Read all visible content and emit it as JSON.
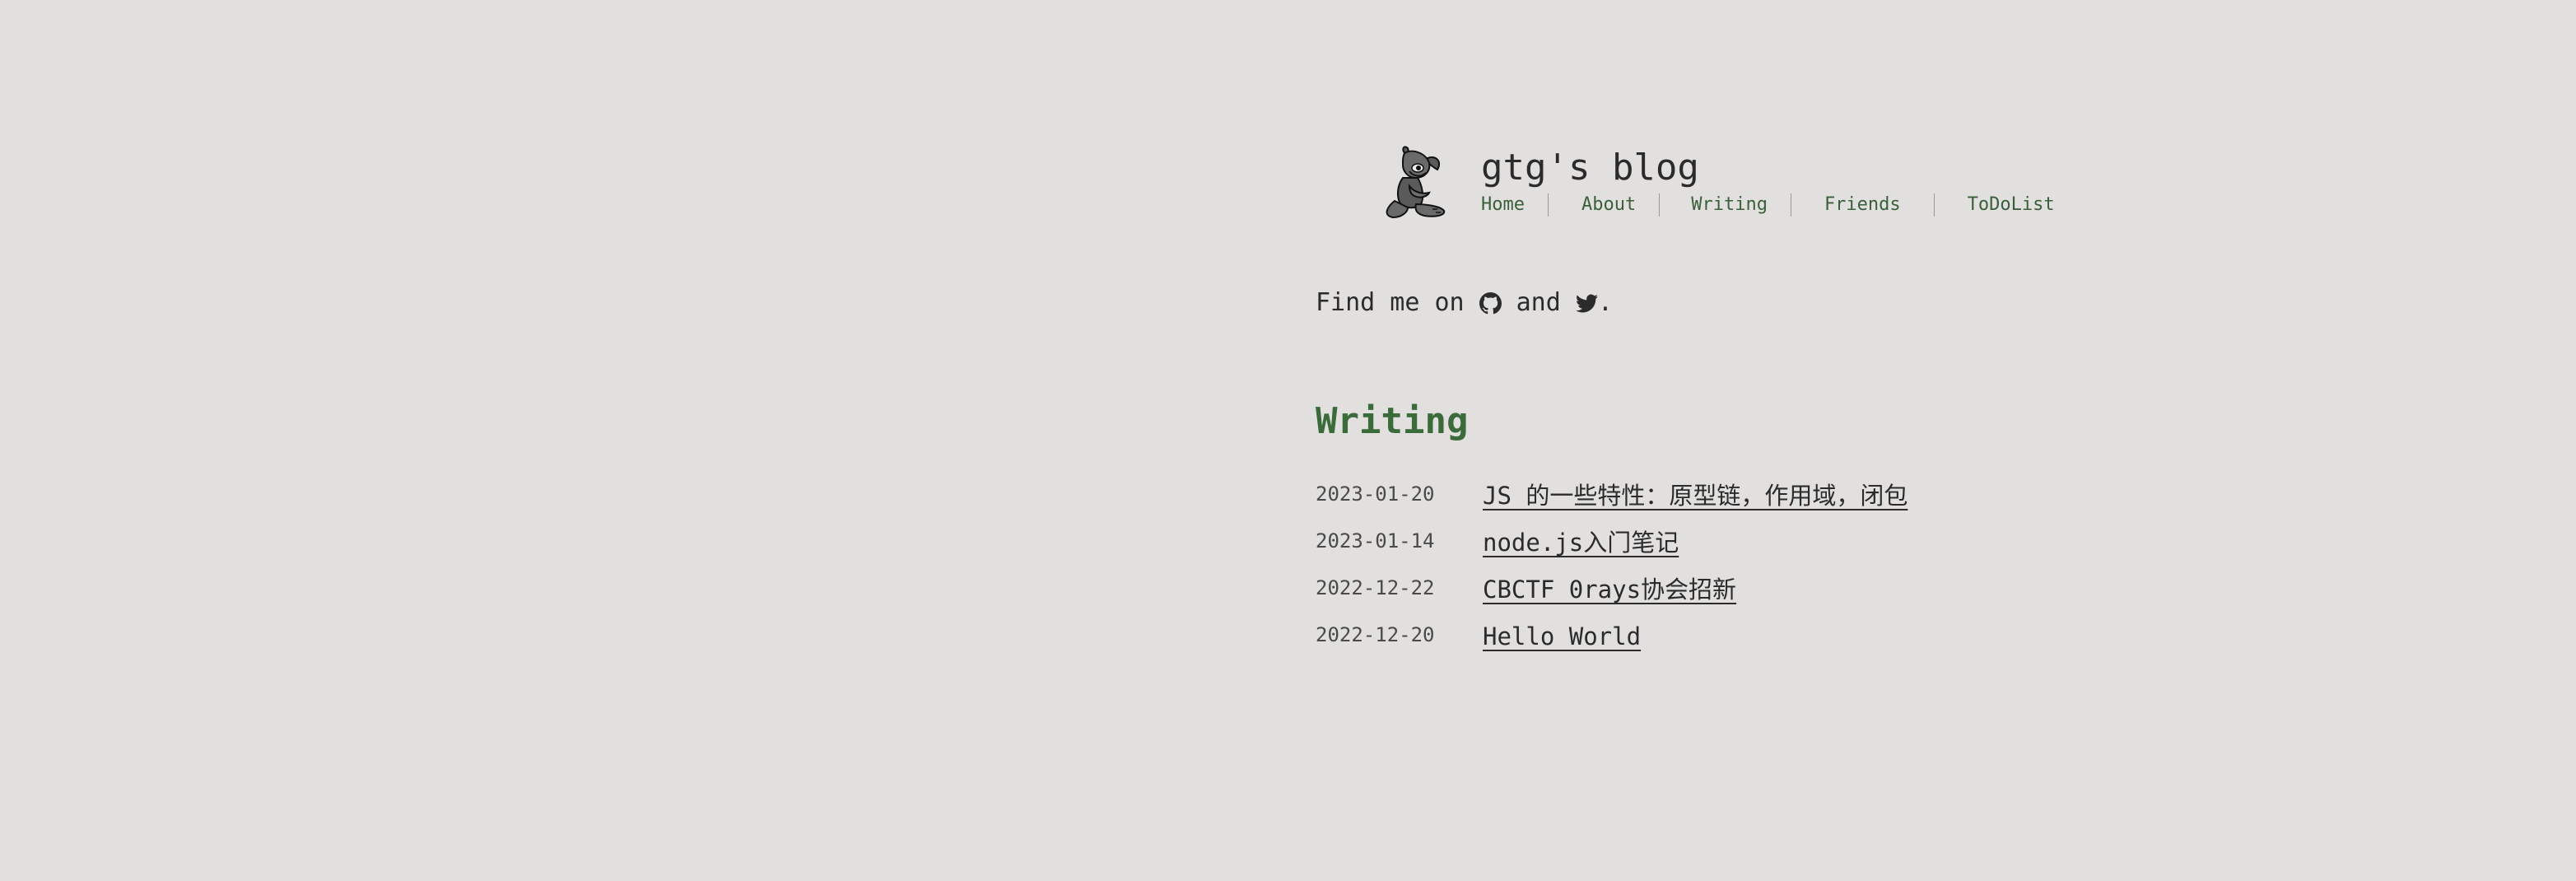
{
  "site": {
    "title": "gtg's blog",
    "logo_icon": "dog-mascot-icon"
  },
  "nav": {
    "items": [
      {
        "label": "Home"
      },
      {
        "label": "About"
      },
      {
        "label": "Writing"
      },
      {
        "label": "Friends"
      },
      {
        "label": "ToDoList"
      }
    ]
  },
  "intro": {
    "prefix": "Find me on",
    "github_icon": "github-icon",
    "conjunction": "and",
    "twitter_icon": "twitter-icon",
    "suffix": "."
  },
  "writing": {
    "heading": "Writing",
    "posts": [
      {
        "date": "2023-01-20",
        "title": "JS 的一些特性：原型链，作用域，闭包"
      },
      {
        "date": "2023-01-14",
        "title": "node.js入门笔记"
      },
      {
        "date": "2022-12-22",
        "title": "CBCTF 0rays协会招新"
      },
      {
        "date": "2022-12-20",
        "title": "Hello World"
      }
    ]
  },
  "colors": {
    "background": "#e1e0de",
    "text": "#2b2b2b",
    "accent_green": "#3b6a3b",
    "nav_green": "#3b5f3b"
  }
}
